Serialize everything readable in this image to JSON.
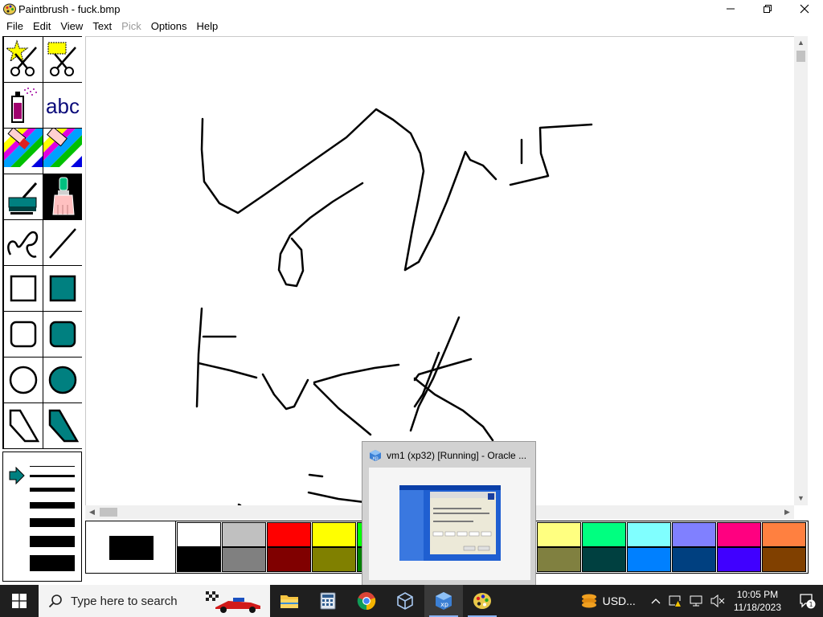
{
  "window": {
    "title": "Paintbrush - fuck.bmp"
  },
  "menu": [
    "File",
    "Edit",
    "View",
    "Text",
    "Pick",
    "Options",
    "Help"
  ],
  "menu_disabled": [
    "Pick"
  ],
  "tools": [
    "star-scissors-icon",
    "rect-scissors-icon",
    "airbrush-icon",
    "text-tool-icon",
    "color-eraser-icon",
    "eraser-icon",
    "paint-roller-icon",
    "brush-icon",
    "curve-icon",
    "line-icon",
    "box-icon",
    "filled-box-icon",
    "rounded-box-icon",
    "filled-rounded-box-icon",
    "circle-icon",
    "filled-circle-icon",
    "polygon-icon",
    "filled-polygon-icon"
  ],
  "tools_text": {
    "text_tool_label": "abc"
  },
  "selected_tool": "brush-icon",
  "current_color": "#000000",
  "palette_top": [
    "#ffffff",
    "#c0c0c0",
    "#ff0000",
    "#ffff00",
    "#00ff00",
    "#00ffff",
    "#0000ff",
    "#ff00ff",
    "#ffff80",
    "#00ff80",
    "#80ffff",
    "#8080ff",
    "#ff0080",
    "#ff8040"
  ],
  "palette_bottom": [
    "#000000",
    "#808080",
    "#800000",
    "#808000",
    "#008000",
    "#008080",
    "#000080",
    "#800080",
    "#808040",
    "#004040",
    "#0080ff",
    "#004080",
    "#4000ff",
    "#804000"
  ],
  "taskbar_preview": {
    "title": "vm1 (xp32) [Running] - Oracle ..."
  },
  "taskbar": {
    "search_placeholder": "Type here to search",
    "tray_usd": "USD...",
    "time": "10:05 PM",
    "date": "11/18/2023",
    "notification_count": "1"
  }
}
